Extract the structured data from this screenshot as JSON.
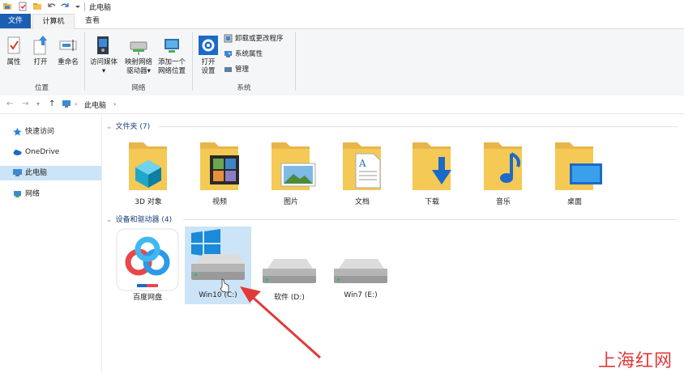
{
  "window": {
    "title": "此电脑"
  },
  "tabs": {
    "file": "文件",
    "computer": "计算机",
    "view": "查看"
  },
  "ribbon": {
    "location": {
      "label": "位置",
      "properties": "属性",
      "open": "打开",
      "rename": "重命名"
    },
    "network": {
      "label": "网络",
      "access_media": "访问媒体",
      "map_drive_1": "映射网络",
      "map_drive_2": "驱动器",
      "add_location_1": "添加一个",
      "add_location_2": "网络位置"
    },
    "system": {
      "label": "系统",
      "open_settings_1": "打开",
      "open_settings_2": "设置",
      "uninstall": "卸载或更改程序",
      "sys_props": "系统属性",
      "manage": "管理"
    }
  },
  "address": {
    "path": "此电脑"
  },
  "sidebar": {
    "items": [
      {
        "label": "快速访问"
      },
      {
        "label": "OneDrive"
      },
      {
        "label": "此电脑"
      },
      {
        "label": "网络"
      }
    ]
  },
  "folders_section": {
    "title": "文件夹 (7)"
  },
  "folders": [
    {
      "label": "3D 对象"
    },
    {
      "label": "视频"
    },
    {
      "label": "图片"
    },
    {
      "label": "文档"
    },
    {
      "label": "下载"
    },
    {
      "label": "音乐"
    },
    {
      "label": "桌面"
    }
  ],
  "devices_section": {
    "title": "设备和驱动器 (4)"
  },
  "devices": [
    {
      "label": "百度网盘"
    },
    {
      "label": "Win10 (C:)"
    },
    {
      "label": "软件 (D:)"
    },
    {
      "label": "Win7 (E:)"
    }
  ],
  "watermark": "上海红网",
  "colors": {
    "accent": "#1b5fb4",
    "selection": "#cce4f7",
    "folder": "#f2c04e",
    "arrow": "#e03a3a"
  }
}
